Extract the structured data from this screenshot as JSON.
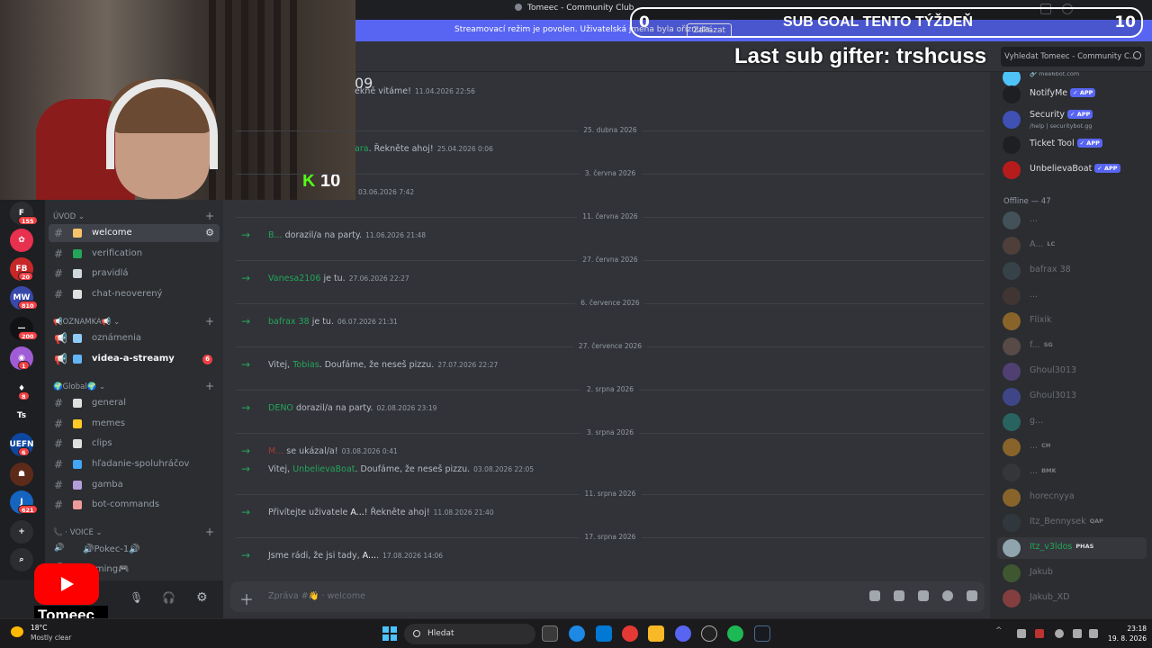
{
  "window": {
    "title": "Tomeec - Community Club"
  },
  "banner": {
    "message": "Streamovací režim je povolen. Uživatelská jména byla oříznuta.",
    "button": "Zakázat"
  },
  "search": {
    "placeholder": "Vyhledat Tomeec - Community C..."
  },
  "overlay": {
    "sub_goal_current": "0",
    "sub_goal_label": "SUB GOAL TENTO TÝŽDEŇ",
    "sub_goal_max": "10",
    "last_gifter": "Last sub gifter: trshcuss",
    "kick_count": "10",
    "kick_letter": "K"
  },
  "servers": [
    {
      "label": "F",
      "color": "#2b2d31",
      "badge": "155"
    },
    {
      "label": "✿",
      "color": "#e8304f",
      "badge": ""
    },
    {
      "label": "FB",
      "color": "#c62828",
      "badge": "20"
    },
    {
      "label": "MW",
      "color": "#3949ab",
      "badge": "810"
    },
    {
      "label": "—",
      "color": "#111214",
      "badge": "200"
    },
    {
      "label": "◉",
      "color": "#a05cd6",
      "badge": "1"
    },
    {
      "label": "♦",
      "color": "#1e1f22",
      "badge": "8"
    },
    {
      "label": "Ts",
      "color": "#1e1f22",
      "badge": ""
    },
    {
      "label": "UEFN",
      "color": "#0d47a1",
      "badge": "6"
    },
    {
      "label": "☗",
      "color": "#5d2a1a",
      "badge": ""
    },
    {
      "label": "J",
      "color": "#1565c0",
      "badge": "621"
    },
    {
      "label": "+",
      "color": "#2b2d31",
      "badge": ""
    },
    {
      "label": "⌕",
      "color": "#2b2d31",
      "badge": ""
    }
  ],
  "sidebar": {
    "categories": [
      {
        "label": "ÚVOD ⌄"
      },
      {
        "label": "📢OZNAMKA📢 ⌄"
      },
      {
        "label": "🌍Global🌍 ⌄"
      },
      {
        "label": "📞 · VOICE ⌄"
      }
    ],
    "channels": [
      {
        "name": "welcome",
        "emoji": "👋"
      },
      {
        "name": "verification",
        "emoji": "✅"
      },
      {
        "name": "pravidlá",
        "emoji": "📖"
      },
      {
        "name": "chat-neoverený",
        "emoji": "📄"
      },
      {
        "name": "oznámenia",
        "emoji": "📢"
      },
      {
        "name": "videa-a-streamy",
        "emoji": "🎥",
        "badge": "6"
      },
      {
        "name": "general",
        "emoji": "💬"
      },
      {
        "name": "memes",
        "emoji": "😂"
      },
      {
        "name": "clips",
        "emoji": "🎬"
      },
      {
        "name": "hľadanie-spoluhráčov",
        "emoji": "🔍"
      },
      {
        "name": "gamba",
        "emoji": "🎰"
      },
      {
        "name": "bot-commands",
        "emoji": "🤖"
      },
      {
        "name": "🔊Pokec-1🔊",
        "emoji": ""
      },
      {
        "name": "Gaming🎮",
        "emoji": ""
      }
    ]
  },
  "user_panel": {
    "display": "Tomeec"
  },
  "messages": [
    {
      "kind": "text",
      "body": "ekně vitáme!",
      "ts": "11.04.2026 22:56",
      "top_time": "09"
    },
    {
      "kind": "divider",
      "label": "25. dubna 2026"
    },
    {
      "kind": "text",
      "user": "ara",
      "body": ". Řekněte ahoj!",
      "ts": "25.04.2026 0:06"
    },
    {
      "kind": "divider",
      "label": "3. června 2026"
    },
    {
      "kind": "text",
      "body": "",
      "ts": "03.06.2026 7:42"
    },
    {
      "kind": "divider",
      "label": "11. června 2026"
    },
    {
      "kind": "join",
      "user": "B...",
      "body": "dorazil/a na party.",
      "ts": "11.06.2026 21:48"
    },
    {
      "kind": "divider",
      "label": "27. června 2026"
    },
    {
      "kind": "join",
      "user": "Vanesa2106",
      "body": "je tu.",
      "ts": "27.06.2026 22:27"
    },
    {
      "kind": "divider",
      "label": "6. července 2026"
    },
    {
      "kind": "join",
      "user": "bafrax 38",
      "body": "je tu.",
      "ts": "06.07.2026 21:31"
    },
    {
      "kind": "divider",
      "label": "27. července 2026"
    },
    {
      "kind": "join",
      "pre": "Vitej,",
      "user": "Tobias",
      "body": ". Doufáme, že neseš pizzu.",
      "ts": "27.07.2026 22:27"
    },
    {
      "kind": "divider",
      "label": "2. srpna 2026"
    },
    {
      "kind": "join",
      "user": "DENO",
      "body": "dorazil/a na party.",
      "ts": "02.08.2026 23:19"
    },
    {
      "kind": "divider",
      "label": "3. srpna 2026"
    },
    {
      "kind": "join",
      "user": "M...",
      "body": "se ukázal/a!",
      "ts": "03.08.2026 0:41",
      "red": true
    },
    {
      "kind": "join",
      "pre": "Vitej,",
      "user": "UnbelievaBoat",
      "body": ". Doufáme, že neseš pizzu.",
      "ts": "03.08.2026 22:05"
    },
    {
      "kind": "divider",
      "label": "11. srpna 2026"
    },
    {
      "kind": "join",
      "pre": "Přivítejte uživatele",
      "user": "A...",
      "body": "! Řekněte ahoj!",
      "ts": "11.08.2026 21:40",
      "white": true
    },
    {
      "kind": "divider",
      "label": "17. srpna 2026"
    },
    {
      "kind": "join",
      "pre": "Jsme rádi, že jsi tady,",
      "user": "A...",
      "body": ".",
      "ts": "17.08.2026 14:06",
      "white": true
    }
  ],
  "composer": {
    "placeholder": "Zpráva #👋 · welcome"
  },
  "members": {
    "online_bots": [
      {
        "name": "",
        "sub": "🔗 mee6bot.com",
        "color": "#4fc3f7",
        "app": false
      },
      {
        "name": "NotifyMe",
        "sub": "",
        "color": "#1e1f22",
        "app": true
      },
      {
        "name": "Security",
        "sub": "/help | securitybot.gg",
        "color": "#3f51b5",
        "app": true
      },
      {
        "name": "Ticket Tool",
        "sub": "",
        "color": "#1e1f22",
        "app": true
      },
      {
        "name": "UnbelievaBoat",
        "sub": "",
        "color": "#b71c1c",
        "app": true
      }
    ],
    "offline_label": "Offline — 47",
    "offline": [
      {
        "name": "...",
        "tag": "",
        "color": "#607d8b"
      },
      {
        "name": "A...",
        "tag": "LC",
        "color": "#795548"
      },
      {
        "name": "bafrax 38",
        "tag": "",
        "color": "#455a64"
      },
      {
        "name": "...",
        "tag": "",
        "color": "#5d4037"
      },
      {
        "name": "Flixik",
        "tag": "",
        "color": "#f9a825"
      },
      {
        "name": "f...",
        "tag": "SG",
        "color": "#8d6e63"
      },
      {
        "name": "Ghoul3013",
        "tag": "",
        "color": "#7e57c2"
      },
      {
        "name": "Ghoul3013",
        "tag": "",
        "color": "#5865f2"
      },
      {
        "name": "g...",
        "tag": "",
        "color": "#26a69a"
      },
      {
        "name": "...",
        "tag": "CH",
        "color": "#f9a825"
      },
      {
        "name": "...",
        "tag": "BMK",
        "color": "#424242"
      },
      {
        "name": "horecnyya",
        "tag": "",
        "color": "#f9a825"
      },
      {
        "name": "Itz_Bennysek",
        "tag": "QAP",
        "color": "#37474f"
      },
      {
        "name": "Itz_v3ldos",
        "tag": "PHAS",
        "color": "#90a4ae",
        "hl": true
      },
      {
        "name": "Jakub",
        "tag": "",
        "color": "#558b2f"
      },
      {
        "name": "Jakub_XD",
        "tag": "",
        "color": "#ef5350"
      }
    ]
  },
  "taskbar": {
    "temp": "18°C",
    "weather": "Mostly clear",
    "search": "Hledat",
    "time": "23:18",
    "date": "19. 8. 2026"
  }
}
